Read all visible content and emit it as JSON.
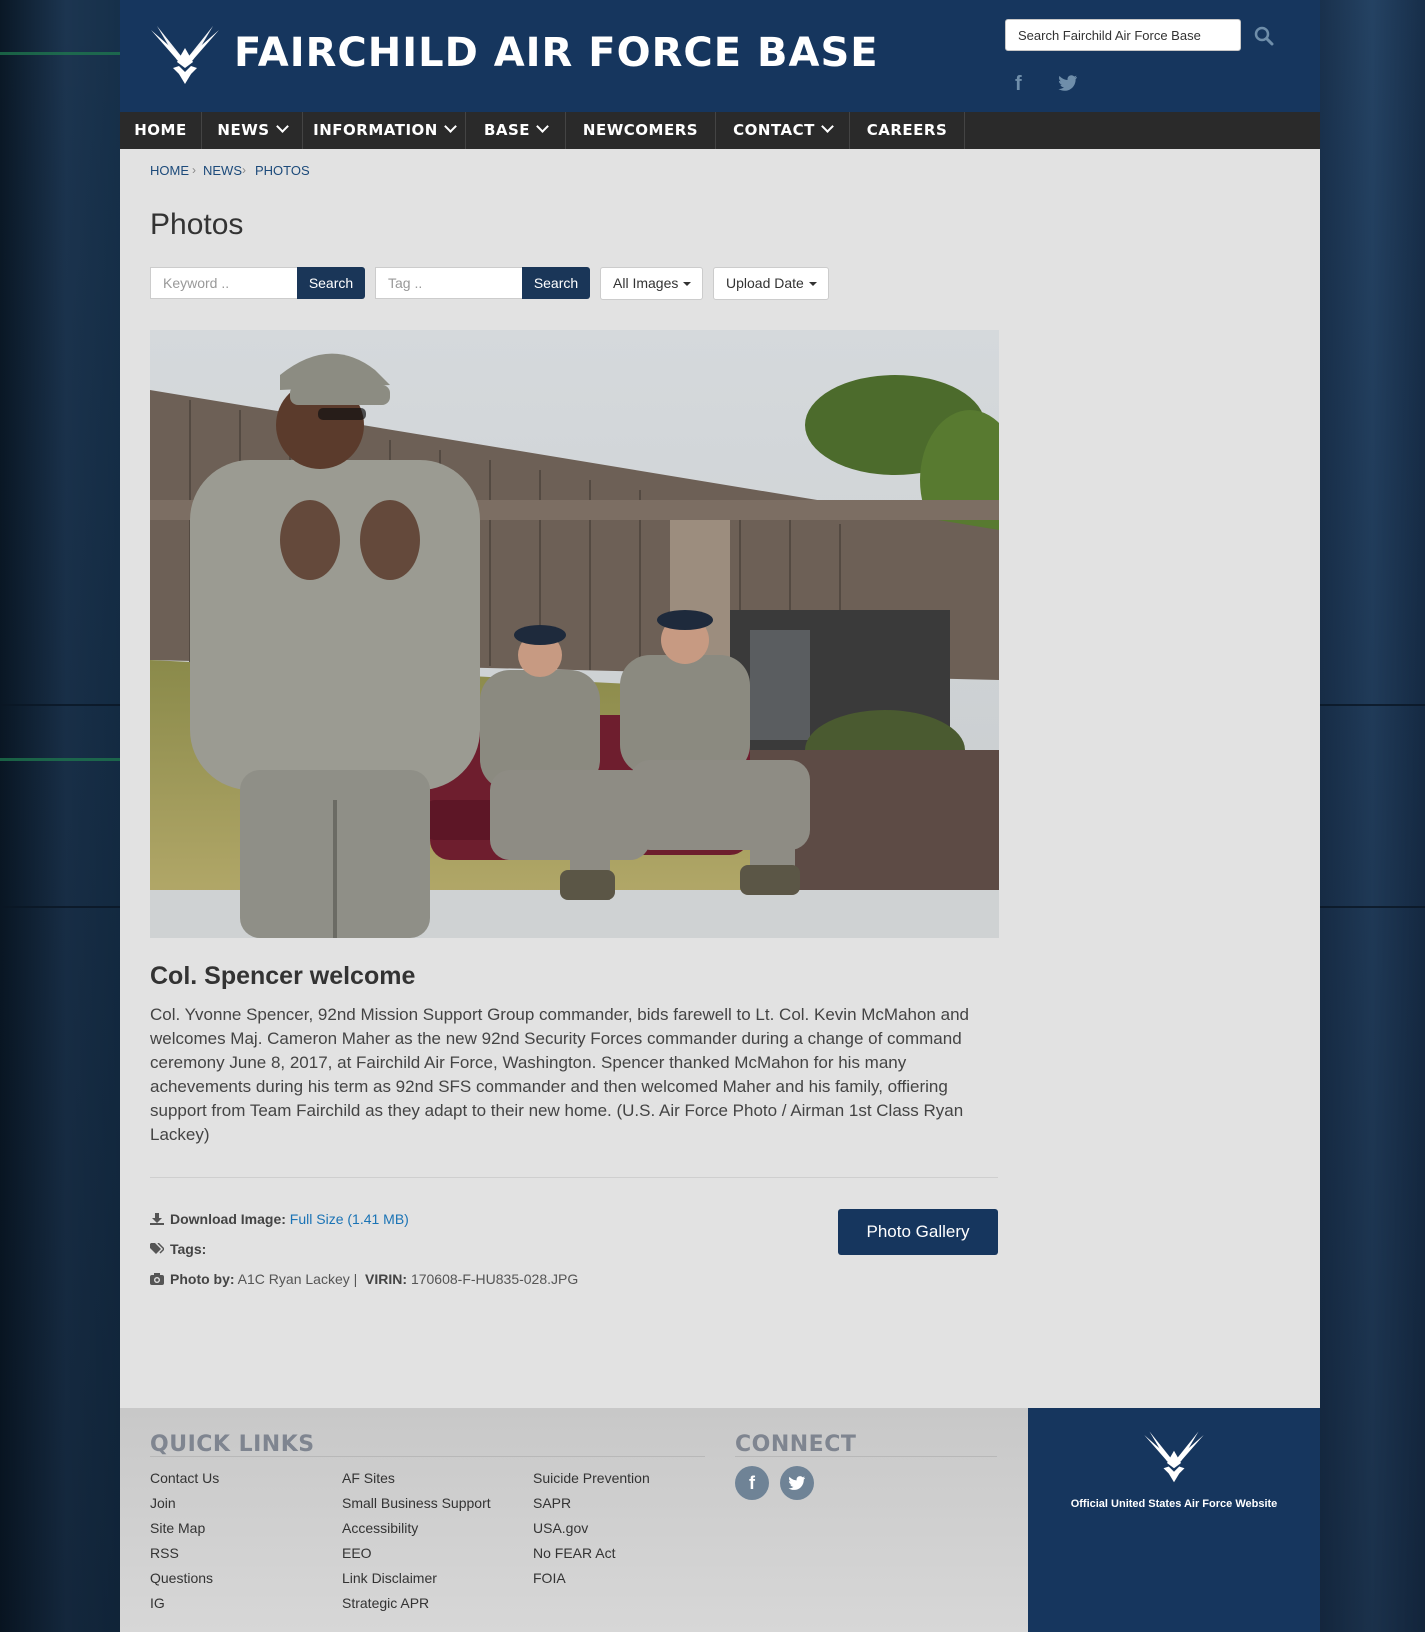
{
  "site": {
    "title": "FAIRCHILD AIR FORCE BASE",
    "search_placeholder": "Search Fairchild Air Force Base"
  },
  "nav": {
    "items": [
      {
        "label": "HOME"
      },
      {
        "label": "NEWS"
      },
      {
        "label": "INFORMATION"
      },
      {
        "label": "BASE"
      },
      {
        "label": "NEWCOMERS"
      },
      {
        "label": "CONTACT"
      },
      {
        "label": "CAREERS"
      }
    ]
  },
  "breadcrumb": [
    "HOME",
    "NEWS",
    "PHOTOS"
  ],
  "page": {
    "title": "Photos"
  },
  "filters": {
    "keyword_placeholder": "Keyword ..",
    "tag_placeholder": "Tag ..",
    "search_label": "Search",
    "images_dropdown": "All Images",
    "date_dropdown": "Upload Date"
  },
  "photo": {
    "title": "Col. Spencer welcome",
    "caption": "Col. Yvonne Spencer, 92nd Mission Support Group commander, bids farewell to Lt. Col. Kevin McMahon and welcomes Maj. Cameron Maher as the new 92nd Security Forces commander during a change of command ceremony June 8, 2017, at Fairchild Air Force, Washington. Spencer thanked McMahon for his many achevements during his term as 92nd SFS commander and then welcomed Maher and his family, offiering support from Team Fairchild as they adapt to their new home. (U.S. Air Force Photo / Airman 1st Class Ryan Lackey)",
    "download_label": "Download Image:",
    "download_link": "Full Size (1.41 MB)",
    "tags_label": "Tags:",
    "photo_by_label": "Photo by:",
    "photo_by": "A1C Ryan Lackey |",
    "virin_label": "VIRIN:",
    "virin": "170608-F-HU835-028.JPG",
    "gallery_button": "Photo Gallery"
  },
  "footer": {
    "quick_links_title": "QUICK LINKS",
    "connect_title": "CONNECT",
    "col1": [
      "Contact Us",
      "Join",
      "Site Map",
      "RSS",
      "Questions",
      "IG"
    ],
    "col2": [
      "AF Sites",
      "Small Business Support",
      "Accessibility",
      "EEO",
      "Link Disclaimer",
      "Strategic APR"
    ],
    "col3": [
      "Suicide Prevention",
      "SAPR",
      "USA.gov",
      "No FEAR Act",
      "FOIA"
    ],
    "official_text": "Official United States Air Force Website"
  },
  "colors": {
    "header_blue": "#16365e",
    "nav_dark": "#2a2a2a",
    "link_blue": "#1a73b5",
    "page_bg": "#e2e2e2"
  }
}
